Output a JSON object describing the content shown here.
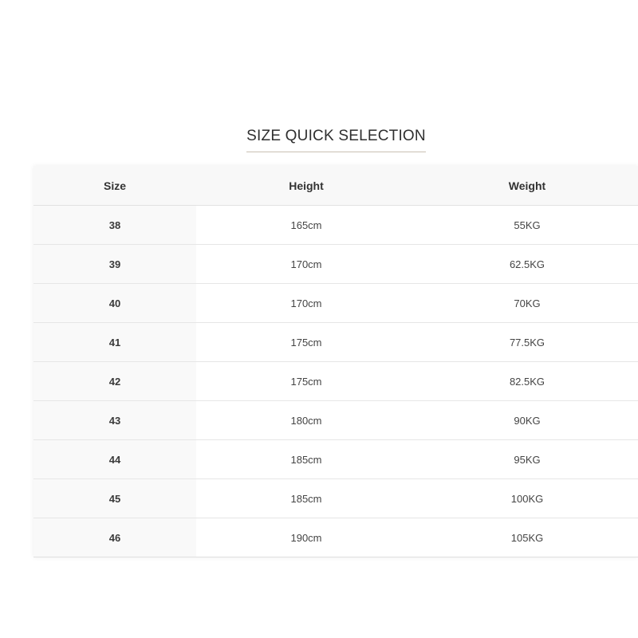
{
  "title": "SIZE QUICK SELECTION",
  "columns": [
    "Size",
    "Height",
    "Weight"
  ],
  "rows": [
    {
      "size": "38",
      "height": "165cm",
      "weight": "55KG"
    },
    {
      "size": "39",
      "height": "170cm",
      "weight": "62.5KG"
    },
    {
      "size": "40",
      "height": "170cm",
      "weight": "70KG"
    },
    {
      "size": "41",
      "height": "175cm",
      "weight": "77.5KG"
    },
    {
      "size": "42",
      "height": "175cm",
      "weight": "82.5KG"
    },
    {
      "size": "43",
      "height": "180cm",
      "weight": "90KG"
    },
    {
      "size": "44",
      "height": "185cm",
      "weight": "95KG"
    },
    {
      "size": "45",
      "height": "185cm",
      "weight": "100KG"
    },
    {
      "size": "46",
      "height": "190cm",
      "weight": "105KG"
    }
  ]
}
